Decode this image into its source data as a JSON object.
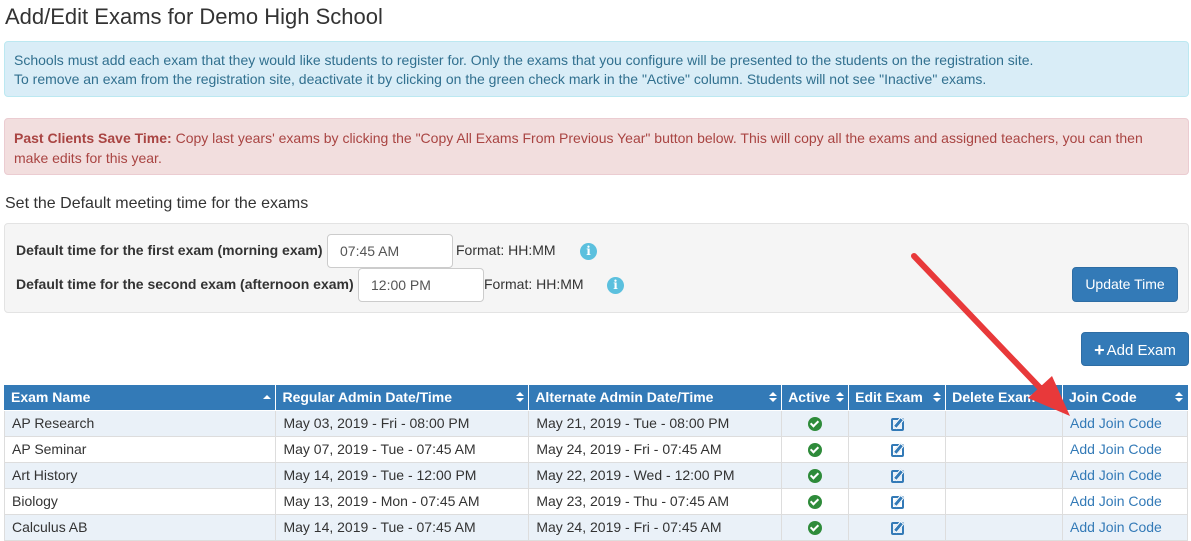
{
  "page": {
    "title": "Add/Edit Exams for Demo High School"
  },
  "info_alert": {
    "line1": "Schools must add each exam that they would like students to register for. Only the exams that you configure will be presented to the students on the registration site.",
    "line2": "To remove an exam from the registration site, deactivate it by clicking on the green check mark in the \"Active\" column. Students will not see \"Inactive\" exams."
  },
  "danger_alert": {
    "bold_label": "Past Clients Save Time:",
    "text": " Copy last years' exams by clicking the \"Copy All Exams From Previous Year\" button below. This will copy all the exams and assigned teachers, you can then make edits for this year."
  },
  "default_time": {
    "heading": "Set the Default meeting time for the exams",
    "first_label": "Default time for the first exam (morning exam)",
    "first_value": "07:45 AM",
    "first_format": "Format: HH:MM",
    "second_label": "Default time for the second exam (afternoon exam)",
    "second_value": "12:00 PM",
    "second_format": "Format: HH:MM",
    "info_icon_glyph": "i",
    "update_button": "Update Time"
  },
  "toolbar": {
    "add_exam_plus": "+",
    "add_exam_label": "Add Exam"
  },
  "table": {
    "columns": [
      "Exam Name",
      "Regular Admin Date/Time",
      "Alternate Admin Date/Time",
      "Active",
      "Edit Exam",
      "Delete Exam",
      "Join Code"
    ],
    "rows": [
      {
        "name": "AP Research",
        "regular": "May 03, 2019 - Fri - 08:00 PM",
        "alternate": "May 21, 2019 - Tue - 08:00 PM",
        "join": "Add Join Code"
      },
      {
        "name": "AP Seminar",
        "regular": "May 07, 2019 - Tue - 07:45 AM",
        "alternate": "May 24, 2019 - Fri - 07:45 AM",
        "join": "Add Join Code"
      },
      {
        "name": "Art History",
        "regular": "May 14, 2019 - Tue - 12:00 PM",
        "alternate": "May 22, 2019 - Wed - 12:00 PM",
        "join": "Add Join Code"
      },
      {
        "name": "Biology",
        "regular": "May 13, 2019 - Mon - 07:45 AM",
        "alternate": "May 23, 2019 - Thu - 07:45 AM",
        "join": "Add Join Code"
      },
      {
        "name": "Calculus AB",
        "regular": "May 14, 2019 - Tue - 07:45 AM",
        "alternate": "May 24, 2019 - Fri - 07:45 AM",
        "join": "Add Join Code"
      }
    ]
  },
  "colors": {
    "primary": "#337ab7",
    "info_bg": "#d9edf7",
    "danger_bg": "#f2dede",
    "active_green": "#2e8b3a",
    "annotation_arrow": "#e8393a"
  }
}
